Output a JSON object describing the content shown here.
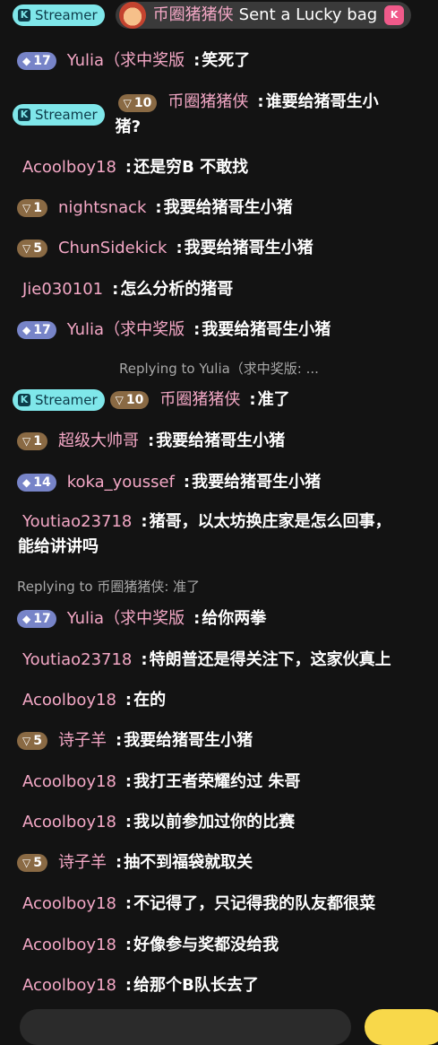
{
  "streamer_label": "Streamer",
  "streamer_letter": "K",
  "lucky_bag": {
    "name": "币圈猪猪侠",
    "text": "Sent a Lucky bag",
    "bag_letter": "K"
  },
  "messages": [
    {
      "badge": "17",
      "badge_type": "diamond",
      "name": "Yulia（求中奖版",
      "text": "笑死了"
    },
    {
      "streamer": true,
      "badge": "10",
      "badge_type": "brown",
      "name": "币圈猪猪侠",
      "text": "谁要给猪哥生小",
      "text2": "猪?"
    },
    {
      "name": "Acoolboy18",
      "text": "还是穷B 不敢找"
    },
    {
      "badge": "1",
      "badge_type": "brown",
      "name": "nightsnack",
      "text": "我要给猪哥生小猪"
    },
    {
      "badge": "5",
      "badge_type": "brown",
      "name": "ChunSidekick",
      "text": "我要给猪哥生小猪"
    },
    {
      "name": "Jie030101",
      "text": "怎么分析的猪哥"
    },
    {
      "badge": "17",
      "badge_type": "diamond",
      "name": "Yulia（求中奖版",
      "text": "我要给猪哥生小猪"
    },
    {
      "reply": "Replying to Yulia（求中奖版: ...",
      "streamer": true,
      "badge": "10",
      "badge_type": "brown",
      "name": "币圈猪猪侠",
      "text": "准了"
    },
    {
      "badge": "1",
      "badge_type": "brown",
      "name": "超级大帅哥",
      "text": "我要给猪哥生小猪"
    },
    {
      "badge": "14",
      "badge_type": "diamond",
      "name": "koka_youssef",
      "text": "我要给猪哥生小猪"
    },
    {
      "name": "Youtiao23718",
      "text": "猪哥，以太坊换庄家是怎么回事，",
      "text2": "能给讲讲吗"
    },
    {
      "reply": "Replying to 币圈猪猪侠: 准了",
      "badge": "17",
      "badge_type": "diamond",
      "name": "Yulia（求中奖版",
      "text": "给你两拳"
    },
    {
      "name": "Youtiao23718",
      "text": "特朗普还是得关注下，这家伙真上"
    },
    {
      "name": "Acoolboy18",
      "text": "在的"
    },
    {
      "badge": "5",
      "badge_type": "brown",
      "name": "诗子羊",
      "text": "我要给猪哥生小猪"
    },
    {
      "name": "Acoolboy18",
      "text": "我打王者荣耀约过 朱哥"
    },
    {
      "name": "Acoolboy18",
      "text": "我以前参加过你的比赛"
    },
    {
      "badge": "5",
      "badge_type": "brown",
      "name": "诗子羊",
      "text": "抽不到福袋就取关"
    },
    {
      "name": "Acoolboy18",
      "text": "不记得了，只记得我的队友都很菜"
    },
    {
      "name": "Acoolboy18",
      "text": "好像参与奖都没给我"
    },
    {
      "name": "Acoolboy18",
      "text": "给那个B队长去了"
    }
  ]
}
